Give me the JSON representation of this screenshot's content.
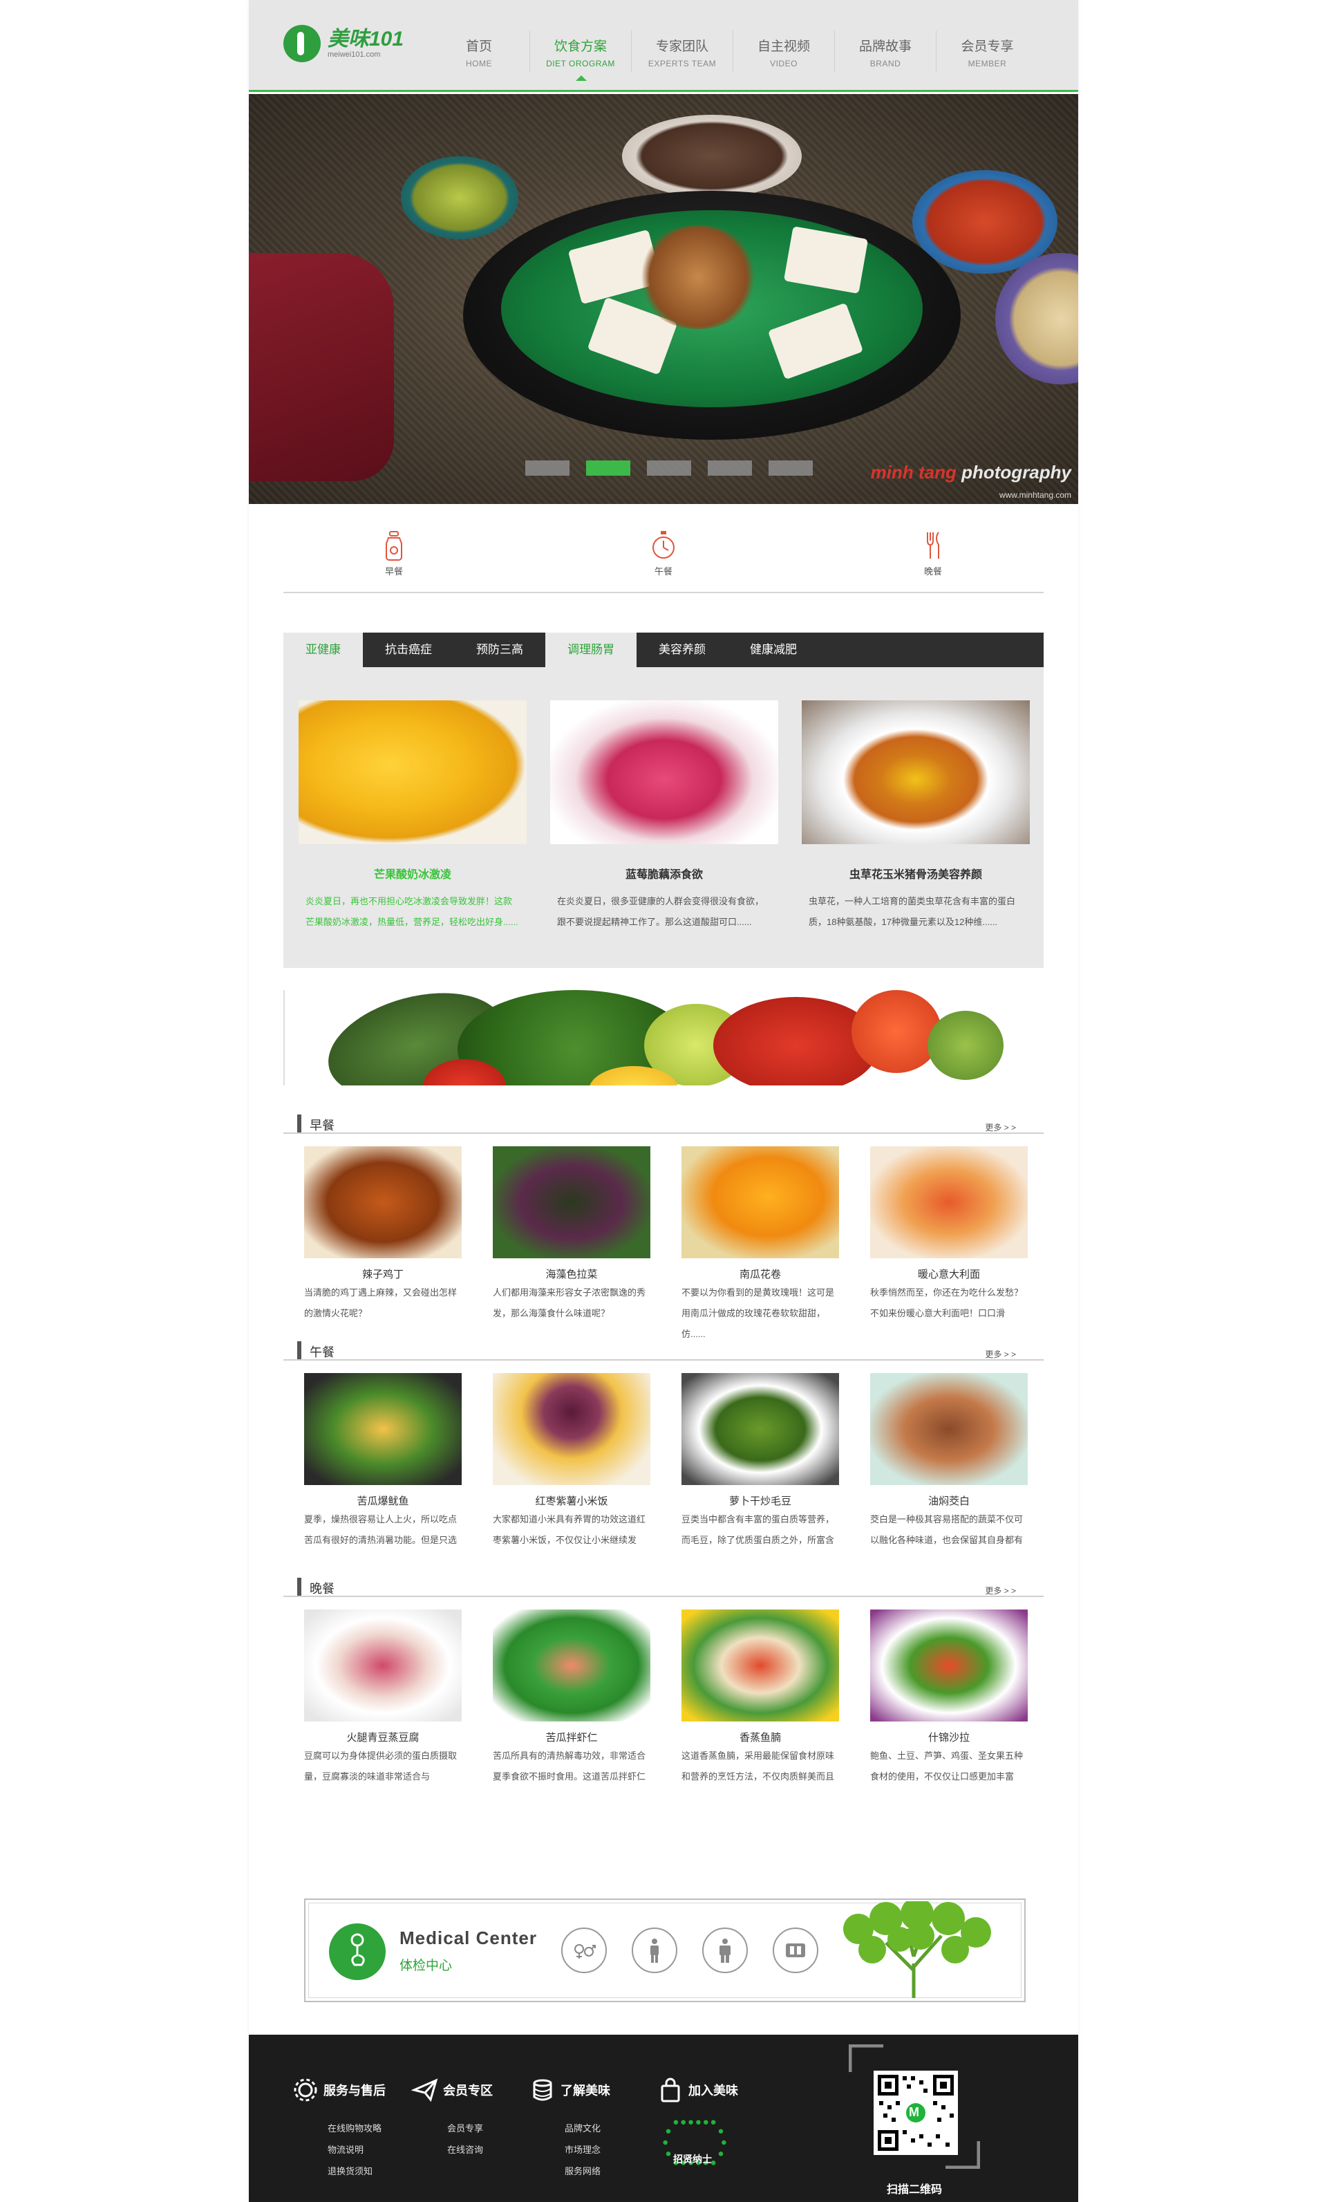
{
  "brand": {
    "name": "美味101",
    "sub": "meiwei101.com"
  },
  "nav": [
    {
      "cn": "首页",
      "en": "HOME"
    },
    {
      "cn": "饮食方案",
      "en": "DIET OROGRAM"
    },
    {
      "cn": "专家团队",
      "en": "EXPERTS TEAM"
    },
    {
      "cn": "自主视频",
      "en": "VIDEO"
    },
    {
      "cn": "品牌故事",
      "en": "BRAND"
    },
    {
      "cn": "会员专享",
      "en": "MEMBER"
    }
  ],
  "hero": {
    "credit_a": "minh tang",
    "credit_b": "photography",
    "url": "www.minhtang.com",
    "slide_count": 5,
    "active_slide": 2
  },
  "meals": [
    {
      "label": "早餐"
    },
    {
      "label": "午餐"
    },
    {
      "label": "晚餐"
    }
  ],
  "tabs": [
    "亚健康",
    "抗击癌症",
    "预防三高",
    "调理肠胃",
    "美容养颜",
    "健康减肥"
  ],
  "featured": [
    {
      "title": "芒果酸奶冰激凌",
      "desc": "炎炎夏日，再也不用担心吃冰激凌会导致发胖！这款芒果酸奶冰激凌，热量低，营养足，轻松吃出好身......"
    },
    {
      "title": "蓝莓脆藕添食欲",
      "desc": "在炎炎夏日，很多亚健康的人群会变得很没有食欲，跟不要说提起精神工作了。那么这道酸甜可口......"
    },
    {
      "title": "虫草花玉米猪骨汤美容养颜",
      "desc": "虫草花，一种人工培育的菌类虫草花含有丰富的蛋白质，18种氨基酸，17种微量元素以及12种维......"
    }
  ],
  "sections": [
    {
      "title": "早餐",
      "more": "更多 > >",
      "items": [
        {
          "name": "辣子鸡丁",
          "desc": "当清脆的鸡丁遇上麻辣，又会碰出怎样的激情火花呢？"
        },
        {
          "name": "海藻色拉菜",
          "desc": "人们都用海藻来形容女子浓密飘逸的秀发，那么海藻食什么味道呢？"
        },
        {
          "name": "南瓜花卷",
          "desc": "不要以为你看到的是黄玫瑰哦！这可是用南瓜汁做成的玫瑰花卷软软甜甜，仿......"
        },
        {
          "name": "暖心意大利面",
          "desc": "秋季悄然而至，你还在为吃什么发愁？不如来份暖心意大利面吧！口口滑"
        }
      ]
    },
    {
      "title": "午餐",
      "more": "更多 > >",
      "items": [
        {
          "name": "苦瓜爆鱿鱼",
          "desc": "夏季，燥热很容易让人上火，所以吃点苦瓜有很好的清热消暑功能。但是只选"
        },
        {
          "name": "红枣紫薯小米饭",
          "desc": "大家都知道小米具有养胃的功效这道红枣紫薯小米饭，不仅仅让小米继续发"
        },
        {
          "name": "萝卜干炒毛豆",
          "desc": "豆类当中都含有丰富的蛋白质等营养，而毛豆，除了优质蛋白质之外，所富含"
        },
        {
          "name": "油焖茭白",
          "desc": "茭白是一种极其容易搭配的蔬菜不仅可以融化各种味道，也会保留其自身都有"
        }
      ]
    },
    {
      "title": "晚餐",
      "more": "更多 > >",
      "items": [
        {
          "name": "火腿青豆蒸豆腐",
          "desc": "豆腐可以为身体提供必须的蛋白质摄取量，豆腐寡淡的味道非常适合与"
        },
        {
          "name": "苦瓜拌虾仁",
          "desc": "苦瓜所具有的清热解毒功效，非常适合夏季食欲不振时食用。这道苦瓜拌虾仁"
        },
        {
          "name": "香蒸鱼腩",
          "desc": "这道香蒸鱼腩，采用最能保留食材原味和营养的烹饪方法，不仅肉质鲜美而且"
        },
        {
          "name": "什锦沙拉",
          "desc": "鲍鱼、土豆、芦笋、鸡蛋、圣女果五种食材的使用，不仅仅让口感更加丰富"
        }
      ]
    }
  ],
  "medical": {
    "en": "Medical Center",
    "cn": "体检中心"
  },
  "footer": {
    "cols": [
      {
        "title": "服务与售后",
        "links": [
          "在线购物攻略",
          "物流说明",
          "退换货须知"
        ]
      },
      {
        "title": "会员专区",
        "links": [
          "会员专享",
          "在线咨询"
        ]
      },
      {
        "title": "了解美味",
        "links": [
          "品牌文化",
          "市场理念",
          "服务网络"
        ]
      },
      {
        "title": "加入美味",
        "links": []
      }
    ],
    "zhaoshang": "招贤纳士",
    "qr_caption": "扫描二维码",
    "qr_letter": "M"
  },
  "colors": {
    "accent": "#3db94a",
    "header_bg": "#e6e6e6",
    "footer_bg": "#1c1c1c",
    "tab_bar": "#2f2f2f"
  }
}
